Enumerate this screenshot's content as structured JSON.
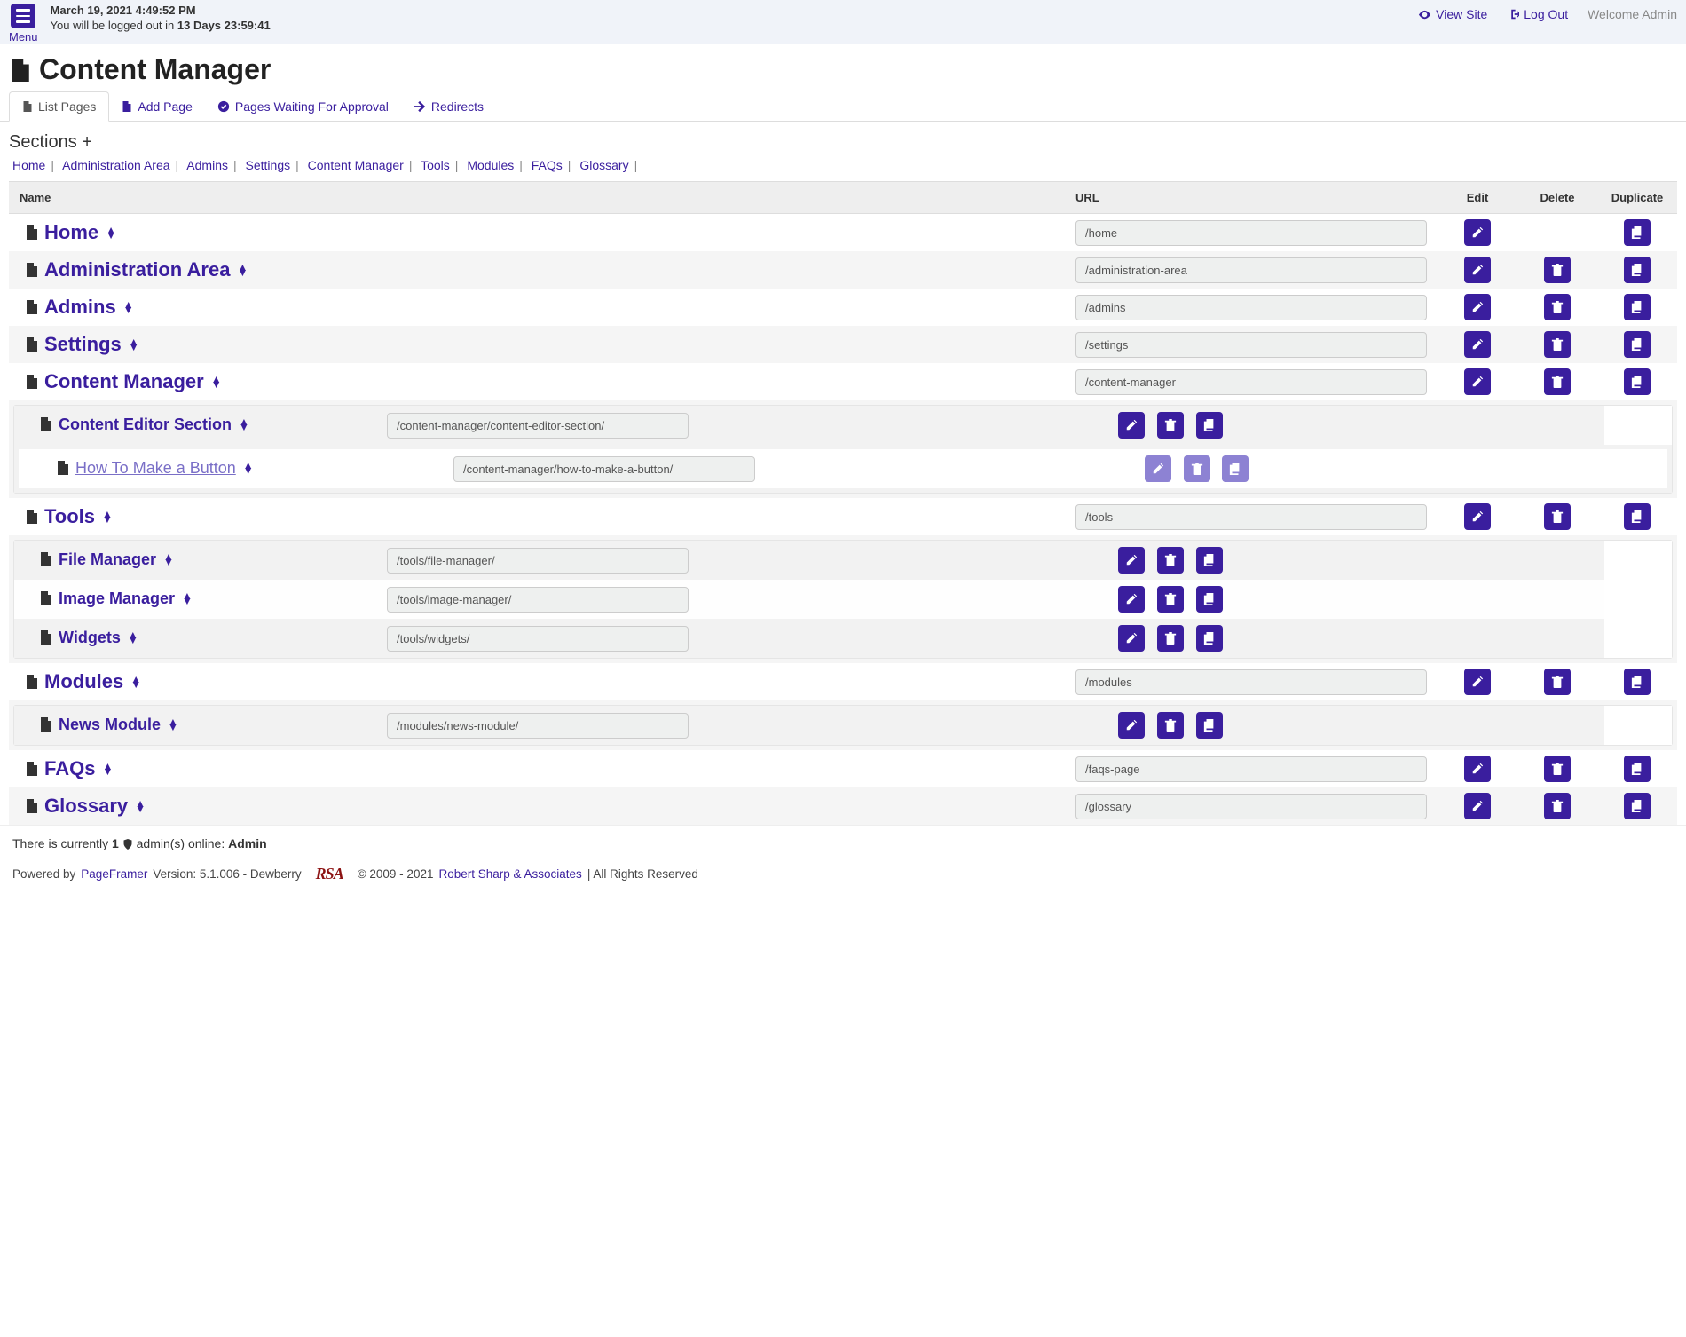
{
  "topbar": {
    "menu_label": "Menu",
    "datetime": "March 19, 2021 4:49:52 PM",
    "logout_prefix": "You will be logged out in ",
    "logout_time": "13 Days 23:59:41",
    "view_site": "View Site",
    "log_out": "Log Out",
    "welcome": "Welcome Admin"
  },
  "page": {
    "title": "Content Manager"
  },
  "tabs": {
    "list": "List Pages",
    "add": "Add Page",
    "approval": "Pages Waiting For Approval",
    "redirects": "Redirects"
  },
  "sections_label": "Sections",
  "breadcrumbs": [
    "Home",
    "Administration Area",
    "Admins",
    "Settings",
    "Content Manager",
    "Tools",
    "Modules",
    "FAQs",
    "Glossary"
  ],
  "columns": {
    "name": "Name",
    "url": "URL",
    "edit": "Edit",
    "delete": "Delete",
    "duplicate": "Duplicate"
  },
  "rows": {
    "home": {
      "name": "Home",
      "url": "/home"
    },
    "admin_area": {
      "name": "Administration Area",
      "url": "/administration-area"
    },
    "admins": {
      "name": "Admins",
      "url": "/admins"
    },
    "settings": {
      "name": "Settings",
      "url": "/settings"
    },
    "content_manager": {
      "name": "Content Manager",
      "url": "/content-manager"
    },
    "content_editor": {
      "name": "Content Editor Section",
      "url": "/content-manager/content-editor-section/"
    },
    "how_to_button": {
      "name": "How To Make a Button",
      "url": "/content-manager/how-to-make-a-button/"
    },
    "tools": {
      "name": "Tools",
      "url": "/tools"
    },
    "file_manager": {
      "name": "File Manager",
      "url": "/tools/file-manager/"
    },
    "image_manager": {
      "name": "Image Manager",
      "url": "/tools/image-manager/"
    },
    "widgets": {
      "name": "Widgets",
      "url": "/tools/widgets/"
    },
    "modules": {
      "name": "Modules",
      "url": "/modules"
    },
    "news_module": {
      "name": "News Module",
      "url": "/modules/news-module/"
    },
    "faqs": {
      "name": "FAQs",
      "url": "/faqs-page"
    },
    "glossary": {
      "name": "Glossary",
      "url": "/glossary"
    }
  },
  "admins_online": {
    "prefix": "There is currently ",
    "count": "1",
    "mid": " admin(s) online: ",
    "names": "Admin"
  },
  "footer": {
    "powered_by": "Powered by ",
    "product": "PageFramer",
    "version": " Version: 5.1.006 - Dewberry",
    "rsa": "RSA",
    "copyright": "© 2009 - 2021 ",
    "company": "Robert Sharp & Associates",
    "rights": " | All Rights Reserved"
  }
}
